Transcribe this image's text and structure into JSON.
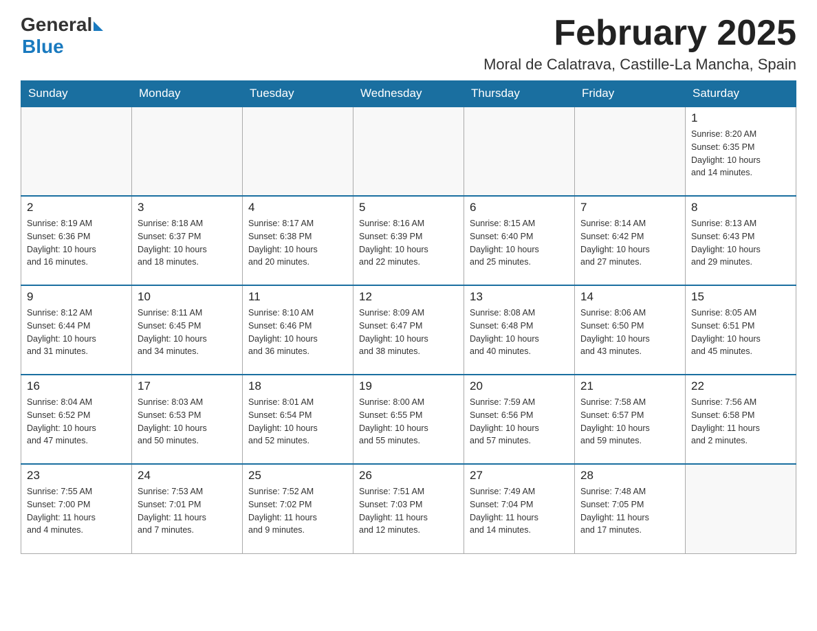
{
  "header": {
    "logo_general": "General",
    "logo_blue": "Blue",
    "month_title": "February 2025",
    "location": "Moral de Calatrava, Castille-La Mancha, Spain"
  },
  "weekdays": [
    "Sunday",
    "Monday",
    "Tuesday",
    "Wednesday",
    "Thursday",
    "Friday",
    "Saturday"
  ],
  "weeks": [
    [
      {
        "day": "",
        "info": ""
      },
      {
        "day": "",
        "info": ""
      },
      {
        "day": "",
        "info": ""
      },
      {
        "day": "",
        "info": ""
      },
      {
        "day": "",
        "info": ""
      },
      {
        "day": "",
        "info": ""
      },
      {
        "day": "1",
        "info": "Sunrise: 8:20 AM\nSunset: 6:35 PM\nDaylight: 10 hours\nand 14 minutes."
      }
    ],
    [
      {
        "day": "2",
        "info": "Sunrise: 8:19 AM\nSunset: 6:36 PM\nDaylight: 10 hours\nand 16 minutes."
      },
      {
        "day": "3",
        "info": "Sunrise: 8:18 AM\nSunset: 6:37 PM\nDaylight: 10 hours\nand 18 minutes."
      },
      {
        "day": "4",
        "info": "Sunrise: 8:17 AM\nSunset: 6:38 PM\nDaylight: 10 hours\nand 20 minutes."
      },
      {
        "day": "5",
        "info": "Sunrise: 8:16 AM\nSunset: 6:39 PM\nDaylight: 10 hours\nand 22 minutes."
      },
      {
        "day": "6",
        "info": "Sunrise: 8:15 AM\nSunset: 6:40 PM\nDaylight: 10 hours\nand 25 minutes."
      },
      {
        "day": "7",
        "info": "Sunrise: 8:14 AM\nSunset: 6:42 PM\nDaylight: 10 hours\nand 27 minutes."
      },
      {
        "day": "8",
        "info": "Sunrise: 8:13 AM\nSunset: 6:43 PM\nDaylight: 10 hours\nand 29 minutes."
      }
    ],
    [
      {
        "day": "9",
        "info": "Sunrise: 8:12 AM\nSunset: 6:44 PM\nDaylight: 10 hours\nand 31 minutes."
      },
      {
        "day": "10",
        "info": "Sunrise: 8:11 AM\nSunset: 6:45 PM\nDaylight: 10 hours\nand 34 minutes."
      },
      {
        "day": "11",
        "info": "Sunrise: 8:10 AM\nSunset: 6:46 PM\nDaylight: 10 hours\nand 36 minutes."
      },
      {
        "day": "12",
        "info": "Sunrise: 8:09 AM\nSunset: 6:47 PM\nDaylight: 10 hours\nand 38 minutes."
      },
      {
        "day": "13",
        "info": "Sunrise: 8:08 AM\nSunset: 6:48 PM\nDaylight: 10 hours\nand 40 minutes."
      },
      {
        "day": "14",
        "info": "Sunrise: 8:06 AM\nSunset: 6:50 PM\nDaylight: 10 hours\nand 43 minutes."
      },
      {
        "day": "15",
        "info": "Sunrise: 8:05 AM\nSunset: 6:51 PM\nDaylight: 10 hours\nand 45 minutes."
      }
    ],
    [
      {
        "day": "16",
        "info": "Sunrise: 8:04 AM\nSunset: 6:52 PM\nDaylight: 10 hours\nand 47 minutes."
      },
      {
        "day": "17",
        "info": "Sunrise: 8:03 AM\nSunset: 6:53 PM\nDaylight: 10 hours\nand 50 minutes."
      },
      {
        "day": "18",
        "info": "Sunrise: 8:01 AM\nSunset: 6:54 PM\nDaylight: 10 hours\nand 52 minutes."
      },
      {
        "day": "19",
        "info": "Sunrise: 8:00 AM\nSunset: 6:55 PM\nDaylight: 10 hours\nand 55 minutes."
      },
      {
        "day": "20",
        "info": "Sunrise: 7:59 AM\nSunset: 6:56 PM\nDaylight: 10 hours\nand 57 minutes."
      },
      {
        "day": "21",
        "info": "Sunrise: 7:58 AM\nSunset: 6:57 PM\nDaylight: 10 hours\nand 59 minutes."
      },
      {
        "day": "22",
        "info": "Sunrise: 7:56 AM\nSunset: 6:58 PM\nDaylight: 11 hours\nand 2 minutes."
      }
    ],
    [
      {
        "day": "23",
        "info": "Sunrise: 7:55 AM\nSunset: 7:00 PM\nDaylight: 11 hours\nand 4 minutes."
      },
      {
        "day": "24",
        "info": "Sunrise: 7:53 AM\nSunset: 7:01 PM\nDaylight: 11 hours\nand 7 minutes."
      },
      {
        "day": "25",
        "info": "Sunrise: 7:52 AM\nSunset: 7:02 PM\nDaylight: 11 hours\nand 9 minutes."
      },
      {
        "day": "26",
        "info": "Sunrise: 7:51 AM\nSunset: 7:03 PM\nDaylight: 11 hours\nand 12 minutes."
      },
      {
        "day": "27",
        "info": "Sunrise: 7:49 AM\nSunset: 7:04 PM\nDaylight: 11 hours\nand 14 minutes."
      },
      {
        "day": "28",
        "info": "Sunrise: 7:48 AM\nSunset: 7:05 PM\nDaylight: 11 hours\nand 17 minutes."
      },
      {
        "day": "",
        "info": ""
      }
    ]
  ]
}
